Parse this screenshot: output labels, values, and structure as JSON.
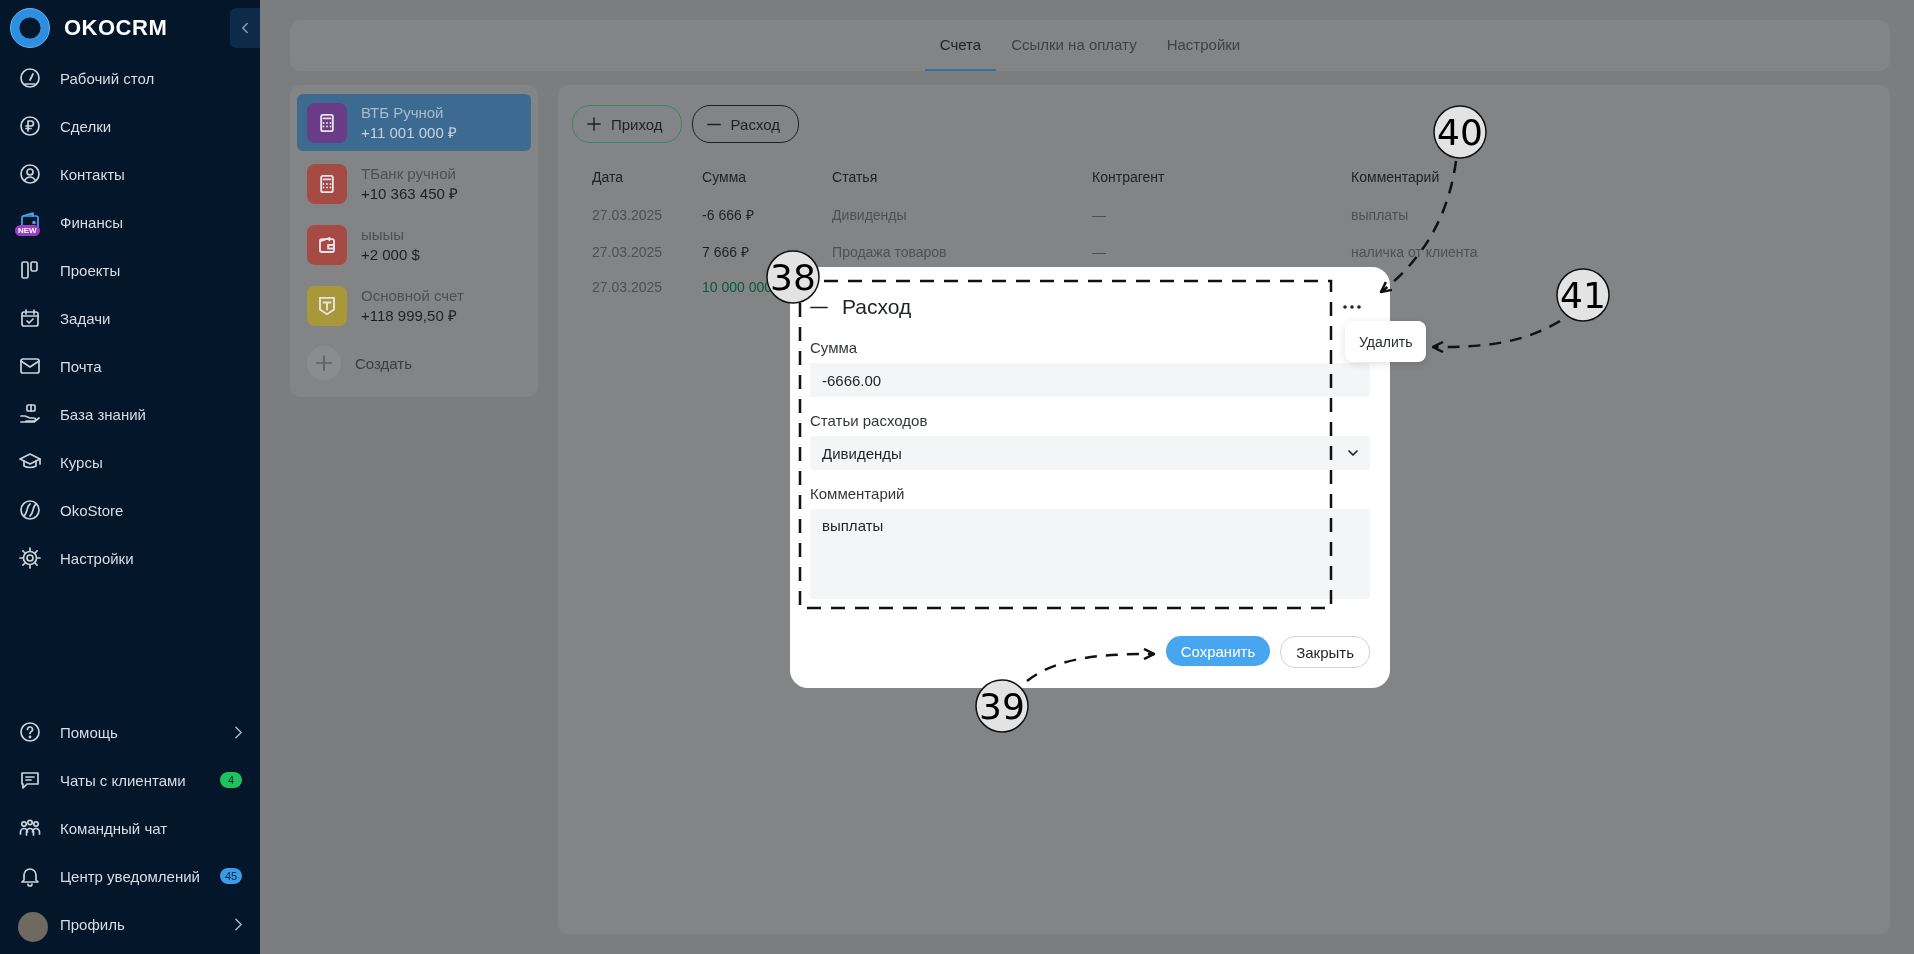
{
  "sidebar": {
    "logo": "OKOCRM",
    "items": [
      {
        "label": "Рабочий стол",
        "submenu": false
      },
      {
        "label": "Сделки",
        "submenu": false
      },
      {
        "label": "Контакты",
        "submenu": false
      },
      {
        "label": "Финансы",
        "submenu": false,
        "badge": {
          "kind": "tag",
          "text": "NEW",
          "color": "#9a3fc4"
        }
      },
      {
        "label": "Проекты",
        "submenu": false
      },
      {
        "label": "Задачи",
        "submenu": false
      },
      {
        "label": "Почта",
        "submenu": false
      },
      {
        "label": "База знаний",
        "submenu": false
      },
      {
        "label": "Курсы",
        "submenu": false
      },
      {
        "label": "OkoStore",
        "submenu": false
      },
      {
        "label": "Настройки",
        "submenu": false
      }
    ],
    "footer_items": [
      {
        "label": "Помощь",
        "submenu": true
      },
      {
        "label": "Чаты с клиентами",
        "submenu": false,
        "badge": {
          "kind": "count",
          "text": "4",
          "color": "#1fc25c"
        }
      },
      {
        "label": "Командный чат",
        "submenu": false
      },
      {
        "label": "Центр уведомлений",
        "submenu": false,
        "badge": {
          "kind": "count",
          "text": "45",
          "color": "#3a9be8"
        }
      },
      {
        "label": "Профиль",
        "submenu": true
      }
    ]
  },
  "tabs": [
    {
      "label": "Счета",
      "selected": true
    },
    {
      "label": "Ссылки на оплату",
      "selected": false
    },
    {
      "label": "Настройки",
      "selected": false
    }
  ],
  "accounts": [
    {
      "name": "ВТБ Ручной",
      "amount": "+11 001 000 ₽",
      "color": "#6a3b86",
      "selected": true
    },
    {
      "name": "ТБанк ручной",
      "amount": "+10 363 450 ₽",
      "color": "#a64a44",
      "selected": false
    },
    {
      "name": "ыыыы",
      "amount": "+2 000 $",
      "color": "#a64a44",
      "selected": false
    },
    {
      "name": "Основной счет",
      "amount": "+118 999,50 ₽",
      "color": "#a8983a",
      "selected": false
    }
  ],
  "create_label": "Создать",
  "actions": [
    "Приход",
    "Расход"
  ],
  "table": {
    "columns": [
      "Дата",
      "Сумма",
      "Статья",
      "Контрагент",
      "Комментарий"
    ],
    "rows": [
      {
        "cells": [
          "27.03.2025",
          "-6 666 ₽",
          "Дивиденды",
          "—",
          "выплаты"
        ],
        "color": "#1e2022"
      },
      {
        "cells": [
          "27.03.2025",
          "7 666 ₽",
          "Продажа товаров",
          "—",
          "наличка от клиента"
        ],
        "color": "#1e2022"
      },
      {
        "cells": [
          "27.03.2025",
          "10 000 000"
        ],
        "color": "#075c34"
      }
    ]
  },
  "modal": {
    "title": "Расход",
    "fields": [
      {
        "kind": "input",
        "label": "Сумма",
        "value": "-6666.00"
      },
      {
        "kind": "select",
        "label": "Статьи расходов",
        "value": "Дивиденды"
      },
      {
        "kind": "textarea",
        "label": "Комментарий",
        "value": "выплаты"
      }
    ],
    "menu": [
      "Удалить"
    ],
    "buttons": [
      "Сохранить",
      "Закрыть"
    ]
  },
  "callouts": [
    {
      "number": "38",
      "kind": "frame"
    },
    {
      "number": "39",
      "kind": "arrow"
    },
    {
      "number": "40",
      "kind": "arrow"
    },
    {
      "number": "41",
      "kind": "arrow"
    }
  ]
}
